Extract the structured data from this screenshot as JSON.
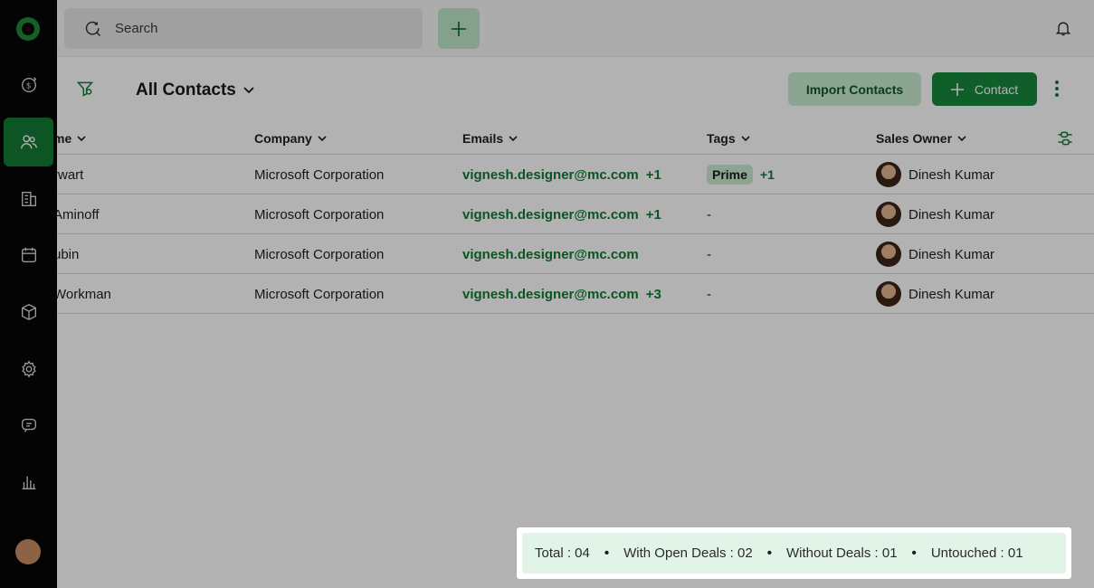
{
  "topbar": {
    "search_placeholder": "Search"
  },
  "toolbar": {
    "view_title": "All Contacts",
    "import_label": "Import Contacts",
    "contact_label": "Contact"
  },
  "table": {
    "columns": [
      "me",
      "Company",
      "Emails",
      "Tags",
      "Sales Owner"
    ],
    "rows": [
      {
        "name": "rwart",
        "company": "Microsoft Corporation",
        "email": "vignesh.designer@mc.com",
        "email_more": "+1",
        "tag": "Prime",
        "tag_more": "+1",
        "owner": "Dinesh Kumar"
      },
      {
        "name": "Aminoff",
        "company": "Microsoft Corporation",
        "email": "vignesh.designer@mc.com",
        "email_more": "+1",
        "tag": "-",
        "tag_more": "",
        "owner": "Dinesh Kumar"
      },
      {
        "name": "ubin",
        "company": "Microsoft Corporation",
        "email": "vignesh.designer@mc.com",
        "email_more": "",
        "tag": "-",
        "tag_more": "",
        "owner": "Dinesh Kumar"
      },
      {
        "name": "Workman",
        "company": "Microsoft Corporation",
        "email": "vignesh.designer@mc.com",
        "email_more": "+3",
        "tag": "-",
        "tag_more": "",
        "owner": "Dinesh Kumar"
      }
    ]
  },
  "summary": {
    "total": "Total : 04",
    "open_deals": "With Open Deals : 02",
    "without_deals": "Without Deals : 01",
    "untouched": "Untouched : 01"
  },
  "colors": {
    "brand_green": "#18873b",
    "accent_light": "#c9ecd2",
    "sidebar_bg": "#060606"
  }
}
